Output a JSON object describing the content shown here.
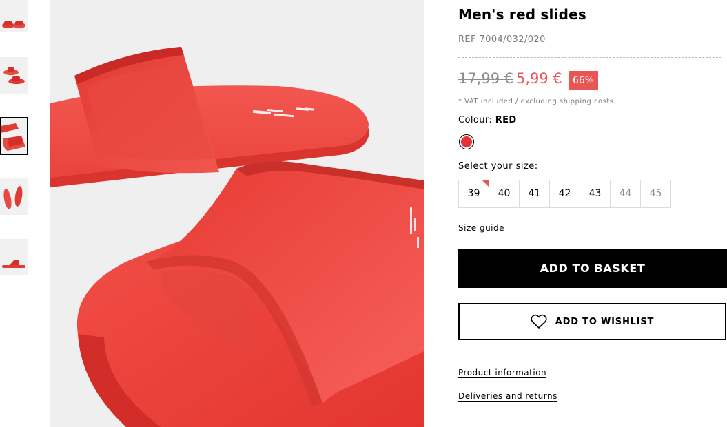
{
  "product": {
    "title": "Men's red slides",
    "ref_label": "REF",
    "ref_value": "7004/032/020",
    "price_old": "17,99 €",
    "price_new": "5,99 €",
    "discount": "66%",
    "vat_note": "* VAT included / excluding shipping costs"
  },
  "colour": {
    "label": "Colour:",
    "value": "RED",
    "swatch_color": "#e63232"
  },
  "size": {
    "label": "Select your size:",
    "options": [
      "39",
      "40",
      "41",
      "42",
      "43",
      "44",
      "45"
    ],
    "unavailable": [
      "44",
      "45"
    ],
    "low_stock": [
      "39"
    ],
    "guide_label": "Size guide"
  },
  "actions": {
    "add_to_basket": "ADD TO BASKET",
    "add_to_wishlist": "ADD TO WISHLIST"
  },
  "links": {
    "product_information": "Product information",
    "deliveries_returns": "Deliveries and returns"
  },
  "gallery": {
    "thumbnail_count": 5,
    "active_index": 2
  },
  "colors": {
    "accent_red": "#e95454",
    "product_red": "#e63232",
    "button_black": "#000000",
    "text_grey": "#7c7c7c"
  },
  "icons": {
    "wishlist": "heart-outline-icon"
  }
}
